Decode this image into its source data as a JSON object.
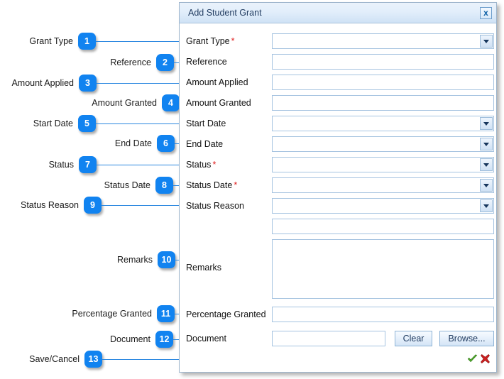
{
  "dialog": {
    "title": "Add Student Grant",
    "close_icon": "close-x-icon",
    "fields": [
      {
        "label": "Grant Type",
        "required": "*",
        "type": "combo"
      },
      {
        "label": "Reference",
        "required": "",
        "type": "text"
      },
      {
        "label": "Amount Applied",
        "required": "",
        "type": "text"
      },
      {
        "label": "Amount Granted",
        "required": "",
        "type": "text"
      },
      {
        "label": "Start Date",
        "required": "",
        "type": "combo"
      },
      {
        "label": "End Date",
        "required": "",
        "type": "combo"
      },
      {
        "label": "Status",
        "required": "*",
        "type": "combo"
      },
      {
        "label": "Status Date",
        "required": "*",
        "type": "combo"
      },
      {
        "label": "Status Reason",
        "required": "",
        "type": "combo"
      },
      {
        "label": "",
        "required": "",
        "type": "text"
      },
      {
        "label": "Remarks",
        "required": "",
        "type": "textarea"
      },
      {
        "label": "Percentage Granted",
        "required": "",
        "type": "text"
      },
      {
        "label": "Document",
        "required": "",
        "type": "file"
      }
    ],
    "buttons": {
      "clear_label": "Clear",
      "browse_label": "Browse..."
    },
    "footer": {
      "save_icon": "green-check-icon",
      "cancel_icon": "red-x-icon"
    }
  },
  "callouts": [
    {
      "number": "1",
      "label": "Grant Type"
    },
    {
      "number": "2",
      "label": "Reference"
    },
    {
      "number": "3",
      "label": "Amount Applied"
    },
    {
      "number": "4",
      "label": "Amount Granted"
    },
    {
      "number": "5",
      "label": "Start Date"
    },
    {
      "number": "6",
      "label": "End Date"
    },
    {
      "number": "7",
      "label": "Status"
    },
    {
      "number": "8",
      "label": "Status Date"
    },
    {
      "number": "9",
      "label": "Status Reason"
    },
    {
      "number": "10",
      "label": "Remarks"
    },
    {
      "number": "11",
      "label": "Percentage Granted"
    },
    {
      "number": "12",
      "label": "Document"
    },
    {
      "number": "13",
      "label": "Save/Cancel"
    }
  ],
  "colors": {
    "badge_blue": "#1183f0",
    "line_blue": "#2a87e0",
    "required_red": "#e02020",
    "title_text": "#1f3a5f",
    "ok_green": "#3ea021",
    "cancel_red": "#cc2222"
  }
}
